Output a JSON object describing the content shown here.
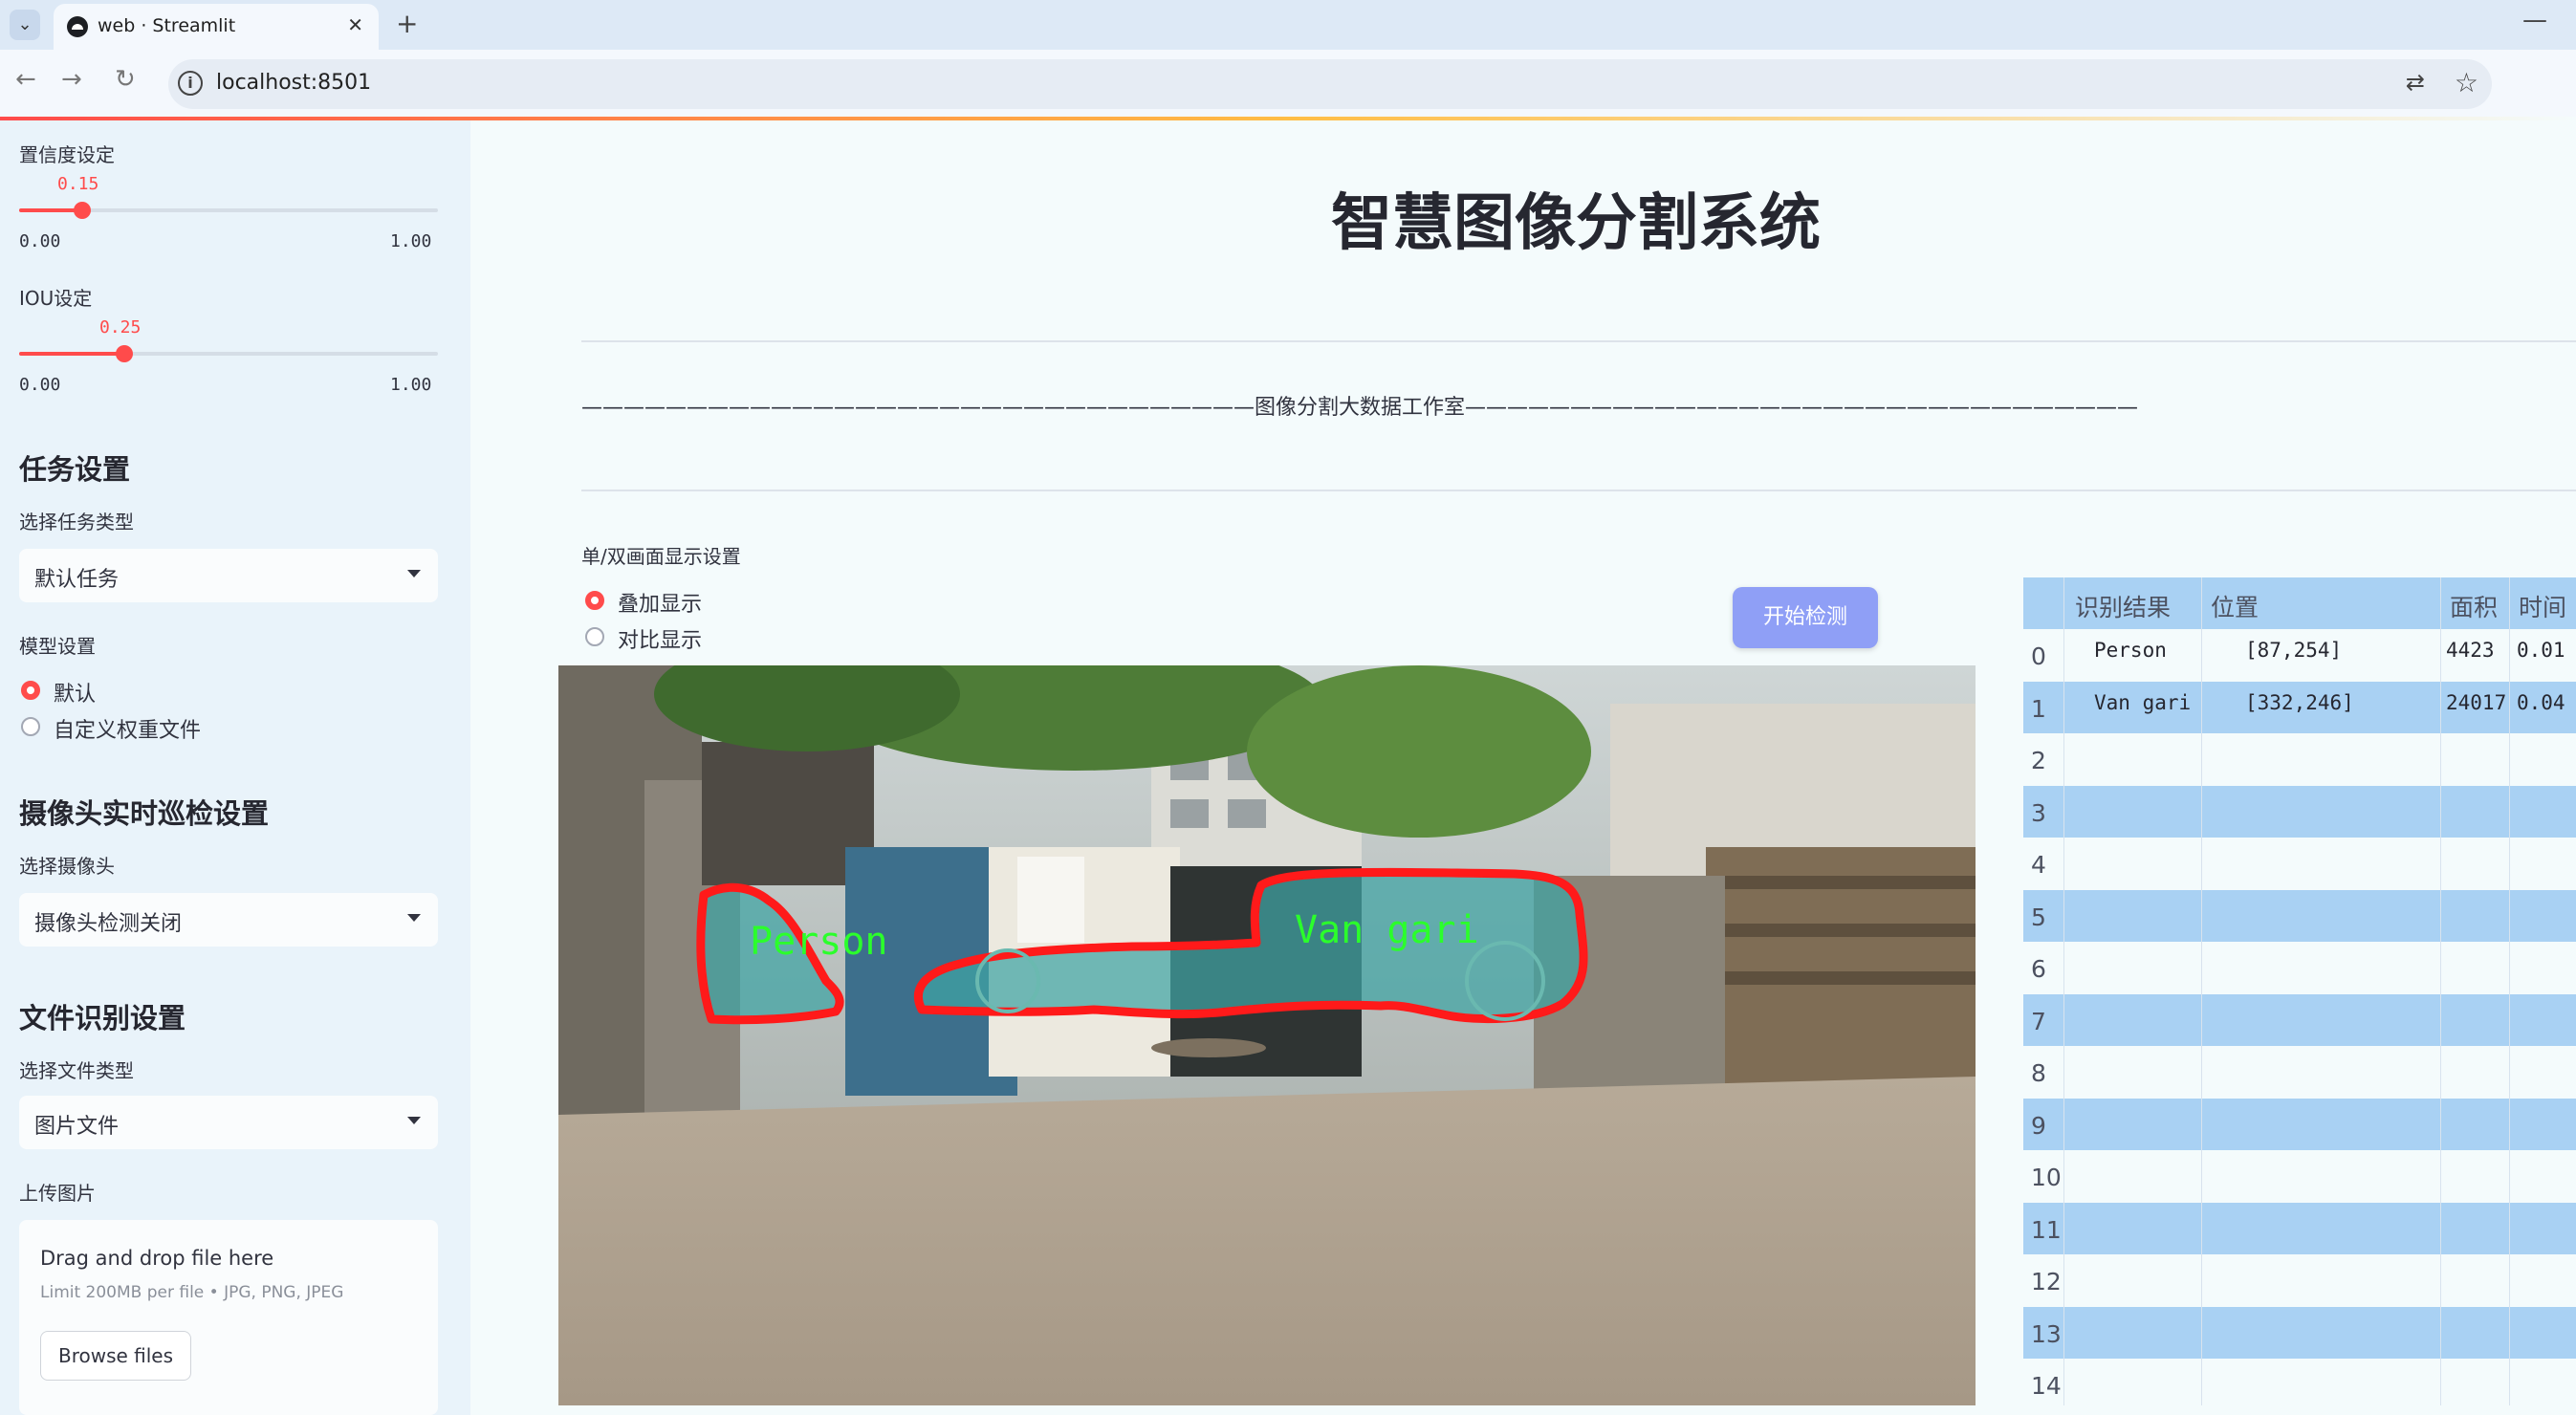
{
  "browser": {
    "tab_title": "web · Streamlit",
    "url": "localhost:8501"
  },
  "sidebar": {
    "confidence": {
      "label": "置信度设定",
      "value": "0.15",
      "level": 0.15,
      "min": "0.00",
      "max": "1.00"
    },
    "iou": {
      "label": "IOU设定",
      "value": "0.25",
      "level": 0.25,
      "min": "0.00",
      "max": "1.00"
    },
    "task_section": "任务设置",
    "task_type_label": "选择任务类型",
    "task_type_value": "默认任务",
    "model_label": "模型设置",
    "model_options": [
      "默认",
      "自定义权重文件"
    ],
    "camera_section": "摄像头实时巡检设置",
    "camera_label": "选择摄像头",
    "camera_value": "摄像头检测关闭",
    "file_section": "文件识别设置",
    "file_type_label": "选择文件类型",
    "file_type_value": "图片文件",
    "upload_label": "上传图片",
    "upload": {
      "title": "Drag and drop file here",
      "subtitle": "Limit 200MB per file • JPG, PNG, JPEG",
      "button": "Browse files"
    }
  },
  "main": {
    "title": "智慧图像分割系统",
    "banner": "————————————————————————————————图像分割大数据工作室————————————————————————————————",
    "display_label": "单/双画面显示设置",
    "display_options": [
      "叠加显示",
      "对比显示"
    ],
    "start_button": "开始检测",
    "detections": [
      "Person",
      "Van gari"
    ]
  },
  "results_table": {
    "headers": [
      "识别结果",
      "位置",
      "面积",
      "时间"
    ],
    "rows": [
      {
        "idx": "0",
        "name": "Person",
        "pos": "[87,254]",
        "area": "4423",
        "time": "0.01"
      },
      {
        "idx": "1",
        "name": "Van gari",
        "pos": "[332,246]",
        "area": "24017",
        "time": "0.04"
      },
      {
        "idx": "2"
      },
      {
        "idx": "3"
      },
      {
        "idx": "4"
      },
      {
        "idx": "5"
      },
      {
        "idx": "6"
      },
      {
        "idx": "7"
      },
      {
        "idx": "8"
      },
      {
        "idx": "9"
      },
      {
        "idx": "10"
      },
      {
        "idx": "11"
      },
      {
        "idx": "12"
      },
      {
        "idx": "13"
      },
      {
        "idx": "14"
      }
    ]
  },
  "colors": {
    "accent": "#ff4b4b",
    "table_stripe": "#a9d1f3",
    "button": "#8f9ff6",
    "mask_outline": "#ff1a1a",
    "label_text": "#2bff2b"
  }
}
